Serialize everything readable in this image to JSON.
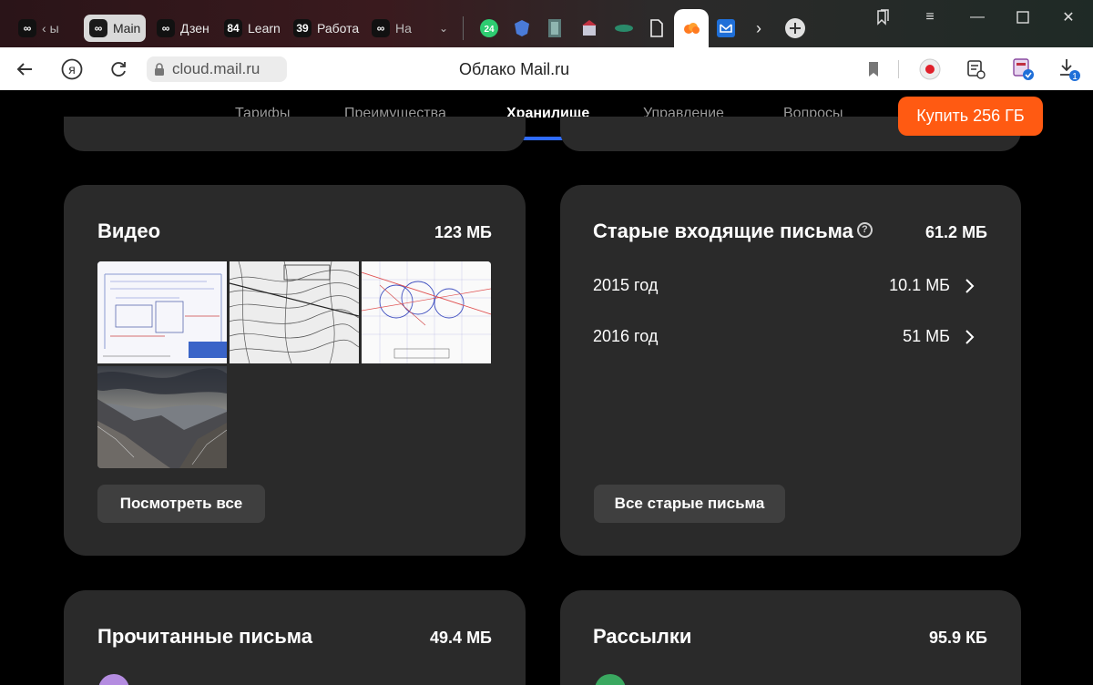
{
  "browser": {
    "tabs": [
      {
        "icon": "infinity-icon",
        "badge": "∞",
        "label": "ы"
      },
      {
        "icon": "infinity-icon",
        "badge": "∞",
        "label": "Main"
      },
      {
        "icon": "infinity-icon",
        "badge": "∞",
        "label": "Дзен"
      },
      {
        "icon": "count-badge",
        "badge": "84",
        "label": "Learn"
      },
      {
        "icon": "count-badge",
        "badge": "39",
        "label": "Работа"
      },
      {
        "icon": "infinity-icon",
        "badge": "∞",
        "label": "На"
      }
    ],
    "pinned_badge": "24",
    "download_badge": "1",
    "url": "cloud.mail.ru",
    "page_title": "Облако Mail.ru"
  },
  "nav": {
    "items": [
      "Тарифы",
      "Преимущества",
      "Хранилище",
      "Управление",
      "Вопросы"
    ],
    "active": "Хранилище",
    "buy_label": "Купить 256 ГБ"
  },
  "video_card": {
    "title": "Видео",
    "size": "123 МБ",
    "button": "Посмотреть все"
  },
  "old_mail_card": {
    "title": "Старые входящие письма",
    "size": "61.2 МБ",
    "rows": [
      {
        "year": "2015 год",
        "size": "10.1 МБ"
      },
      {
        "year": "2016 год",
        "size": "51 МБ"
      }
    ],
    "button": "Все старые письма"
  },
  "read_mail_card": {
    "title": "Прочитанные письма",
    "size": "49.4 МБ"
  },
  "newsletters_card": {
    "title": "Рассылки",
    "size": "95.9 КБ"
  },
  "colors": {
    "accent": "#ff5a12",
    "nav_underline": "#2f6bff",
    "card_bg": "#2a2a2a",
    "button_bg": "#3f3f3f"
  }
}
